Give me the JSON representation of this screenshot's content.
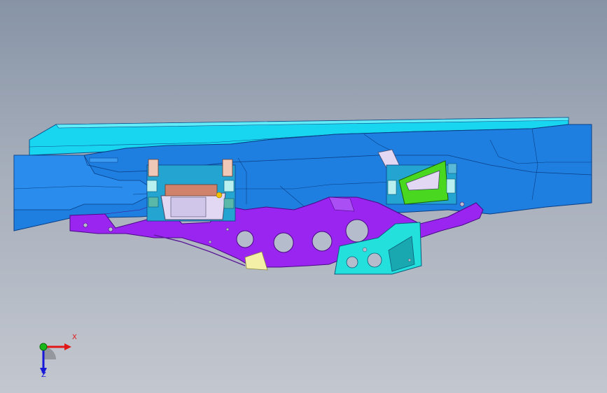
{
  "viewport": {
    "background_top": "#8794a6",
    "background_bottom": "#c3c7cf"
  },
  "model": {
    "parts": [
      {
        "name": "frame-rail",
        "color": "#1e7fe0"
      },
      {
        "name": "top-rail-flange",
        "color": "#19d6f0"
      },
      {
        "name": "bracket-plate",
        "color": "#9a25f0"
      },
      {
        "name": "mount-bracket",
        "color": "#24e0dc"
      },
      {
        "name": "mount-cup",
        "color": "#49d81f"
      },
      {
        "name": "engine-mount",
        "color": "#e3d8f3"
      },
      {
        "name": "mount-pad",
        "color": "#d1826a"
      },
      {
        "name": "gusset",
        "color": "#f4f0a8"
      }
    ]
  },
  "triad": {
    "x_label": "X",
    "y_label": "Y",
    "z_label": "Z",
    "x_color": "#e01818",
    "y_color": "#18b818",
    "z_color": "#1818d8"
  }
}
